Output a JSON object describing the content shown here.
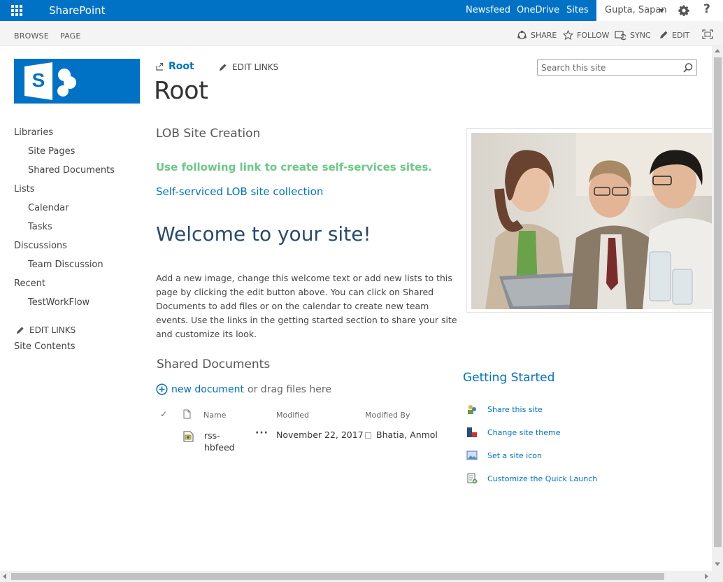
{
  "suite_bar": {
    "brand": "SharePoint",
    "links": [
      "Newsfeed",
      "OneDrive",
      "Sites"
    ],
    "user": "Gupta, Sapan",
    "help": "?"
  },
  "ribbon": {
    "tabs": [
      "BROWSE",
      "PAGE"
    ],
    "actions": [
      "SHARE",
      "FOLLOW",
      "SYNC",
      "EDIT"
    ]
  },
  "left_nav": {
    "items": [
      {
        "label": "Libraries",
        "level": 0
      },
      {
        "label": "Site Pages",
        "level": 1
      },
      {
        "label": "Shared Documents",
        "level": 1
      },
      {
        "label": "Lists",
        "level": 0
      },
      {
        "label": "Calendar",
        "level": 1
      },
      {
        "label": "Tasks",
        "level": 1
      },
      {
        "label": "Discussions",
        "level": 0
      },
      {
        "label": "Team Discussion",
        "level": 1
      },
      {
        "label": "Recent",
        "level": 0
      },
      {
        "label": "TestWorkFlow",
        "level": 1
      }
    ],
    "edit_links": "EDIT LINKS",
    "site_contents": "Site Contents"
  },
  "header": {
    "breadcrumb": "Root",
    "edit_links": "EDIT LINKS",
    "title": "Root",
    "search_placeholder": "Search this site"
  },
  "main": {
    "lob_heading": "LOB Site Creation",
    "lob_instruction": "Use following link to create self-services sites.",
    "lob_link": "Self-serviced LOB site collection",
    "welcome_title": "Welcome to your site!",
    "welcome_text": "Add a new image, change this welcome text or add new lists to this page by clicking the edit button above. You can click on Shared Documents to add files or on the calendar to create new team events. Use the links in the getting started section to share your site and customize its look."
  },
  "shared_docs": {
    "heading": "Shared Documents",
    "new_document": "new document",
    "drag_text": "or drag files here",
    "columns": [
      "Name",
      "Modified",
      "Modified By"
    ],
    "rows": [
      {
        "name": "rss-hbfeed",
        "modified": "November 22, 2017",
        "modified_by": "Bhatia, Anmol"
      }
    ]
  },
  "getting_started": {
    "heading": "Getting Started",
    "items": [
      "Share this site",
      "Change site theme",
      "Set a site icon",
      "Customize the Quick Launch"
    ]
  },
  "colors": {
    "brand_blue": "#0072c6",
    "instruction_green": "#6cc987",
    "welcome_title": "#2a4a6e"
  }
}
